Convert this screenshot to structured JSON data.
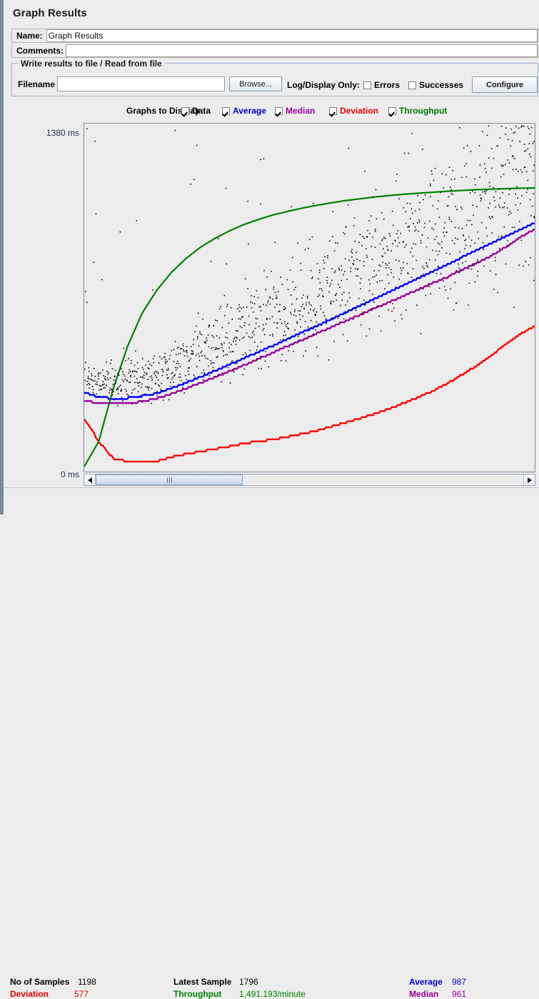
{
  "window": {
    "title": "Graph Results"
  },
  "form": {
    "name_label": "Name:",
    "name_value": "Graph Results",
    "comments_label": "Comments:",
    "comments_value": ""
  },
  "file_group": {
    "legend": "Write results to file / Read from file",
    "filename_label": "Filename",
    "filename_value": "",
    "browse_label": "Browse...",
    "log_display_label": "Log/Display Only:",
    "errors_label": "Errors",
    "errors_checked": false,
    "successes_label": "Successes",
    "successes_checked": false,
    "configure_label": "Configure"
  },
  "graphs_to_display": {
    "label": "Graphs to Display",
    "items": [
      {
        "label": "Data",
        "checked": true,
        "color": "#000000"
      },
      {
        "label": "Average",
        "checked": true,
        "color": "#0000cc"
      },
      {
        "label": "Median",
        "checked": true,
        "color": "#9b009b"
      },
      {
        "label": "Deviation",
        "checked": true,
        "color": "#ee0000"
      },
      {
        "label": "Throughput",
        "checked": true,
        "color": "#007700"
      }
    ]
  },
  "axis": {
    "y_top_label": "1380 ms",
    "y_bottom_label": "0 ms"
  },
  "scrollbar": {
    "left_arrow": "scroll-left",
    "right_arrow": "scroll-right",
    "thumb_position_pct": 0,
    "thumb_width_pct": 33
  },
  "status": {
    "no_of_samples_label": "No of Samples",
    "no_of_samples_value": "1198",
    "deviation_label": "Deviation",
    "deviation_value": "577",
    "latest_sample_label": "Latest Sample",
    "latest_sample_value": "1796",
    "throughput_label": "Throughput",
    "throughput_value": "1,491.193/minute",
    "average_label": "Average",
    "average_value": "987",
    "median_label": "Median",
    "median_value": "961"
  },
  "chart_data": {
    "type": "line",
    "title": "Graph Results",
    "xlabel": "",
    "ylabel": "ms",
    "ylim": [
      0,
      1380
    ],
    "grid": false,
    "legend": [
      "Data",
      "Average",
      "Median",
      "Deviation",
      "Throughput"
    ],
    "legend_position": "top",
    "samples": 1198,
    "colors": {
      "data": "#000000",
      "average": "#0000ff",
      "median": "#9b009b",
      "deviation": "#ff0000",
      "throughput": "#008000",
      "plot_background": "#ececec",
      "plot_border": "#7d8a9c"
    },
    "series": [
      {
        "name": "Average",
        "color": "#0000ff",
        "values": [
          315,
          295,
          290,
          292,
          300,
          310,
          330,
          352,
          375,
          400,
          425,
          450,
          475,
          500,
          525,
          552,
          578,
          605,
          632,
          658,
          685,
          712,
          740,
          768,
          795,
          822,
          850,
          878,
          905,
          932,
          960,
          987
        ]
      },
      {
        "name": "Median",
        "color": "#9b009b",
        "values": [
          280,
          272,
          270,
          272,
          278,
          290,
          308,
          330,
          352,
          375,
          398,
          422,
          448,
          472,
          498,
          522,
          548,
          572,
          598,
          622,
          648,
          672,
          698,
          722,
          748,
          772,
          800,
          828,
          855,
          890,
          930,
          961
        ]
      },
      {
        "name": "Deviation",
        "color": "#ff0000",
        "values": [
          210,
          120,
          52,
          40,
          38,
          42,
          58,
          70,
          80,
          90,
          100,
          112,
          120,
          128,
          138,
          150,
          162,
          178,
          195,
          212,
          230,
          250,
          272,
          295,
          320,
          350,
          385,
          420,
          460,
          505,
          545,
          577
        ]
      },
      {
        "name": "Throughput",
        "color": "#008000",
        "values": [
          20,
          120,
          330,
          500,
          630,
          720,
          790,
          845,
          890,
          925,
          955,
          980,
          1000,
          1018,
          1032,
          1045,
          1056,
          1066,
          1075,
          1082,
          1089,
          1095,
          1100,
          1104,
          1108,
          1112,
          1115,
          1118,
          1120,
          1122,
          1124,
          1125
        ]
      }
    ],
    "scatter_note": "Data series rendered as individual black sample points rising diagonally from ~300 ms to ~1380 ms",
    "scatter_points_count": 1198
  }
}
